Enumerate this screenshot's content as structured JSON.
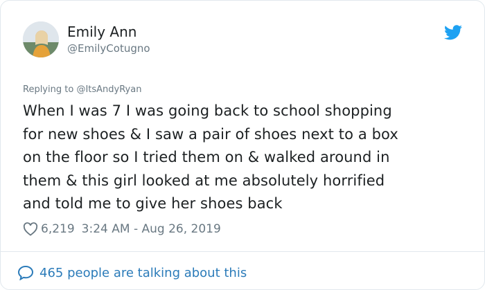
{
  "author": {
    "name": "Emily Ann",
    "handle": "@EmilyCotugno"
  },
  "reply": {
    "prefix": "Replying to",
    "mention": "@ItsAndyRyan"
  },
  "tweet": {
    "lines": [
      "When I was 7 I was going back to school shopping",
      "for new shoes & I saw a pair of shoes next to a box",
      "on the floor so I tried them on & walked around in",
      "them & this girl looked at me absolutely horrified",
      "and told me to give her shoes back"
    ]
  },
  "meta": {
    "likes": "6,219",
    "timestamp": "3:24 AM - Aug 26, 2019"
  },
  "footer": {
    "talking": "465 people are talking about this"
  },
  "icons": {
    "logo": "twitter-bird-icon",
    "like": "heart-outline-icon",
    "conversation": "speech-bubble-icon"
  },
  "colors": {
    "brand": "#1da1f2",
    "link": "#2b7bb9",
    "muted": "#697882",
    "text": "#1c2022"
  }
}
